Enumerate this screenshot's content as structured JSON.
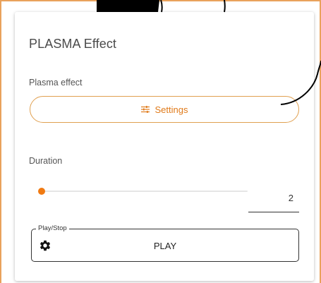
{
  "card": {
    "title": "PLASMA Effect",
    "plasma_label": "Plasma effect",
    "settings_button": {
      "label": "Settings",
      "icon": "tune-icon",
      "color": "#e07a1a"
    },
    "duration": {
      "label": "Duration",
      "value": "2",
      "slider_fraction": 0.0,
      "accent": "#f07a12"
    },
    "play_stop": {
      "legend": "Play/Stop",
      "icon": "gear-icon",
      "button_label": "PLAY"
    }
  },
  "colors": {
    "frame_border": "#e9a25c",
    "accent": "#f07a12"
  }
}
